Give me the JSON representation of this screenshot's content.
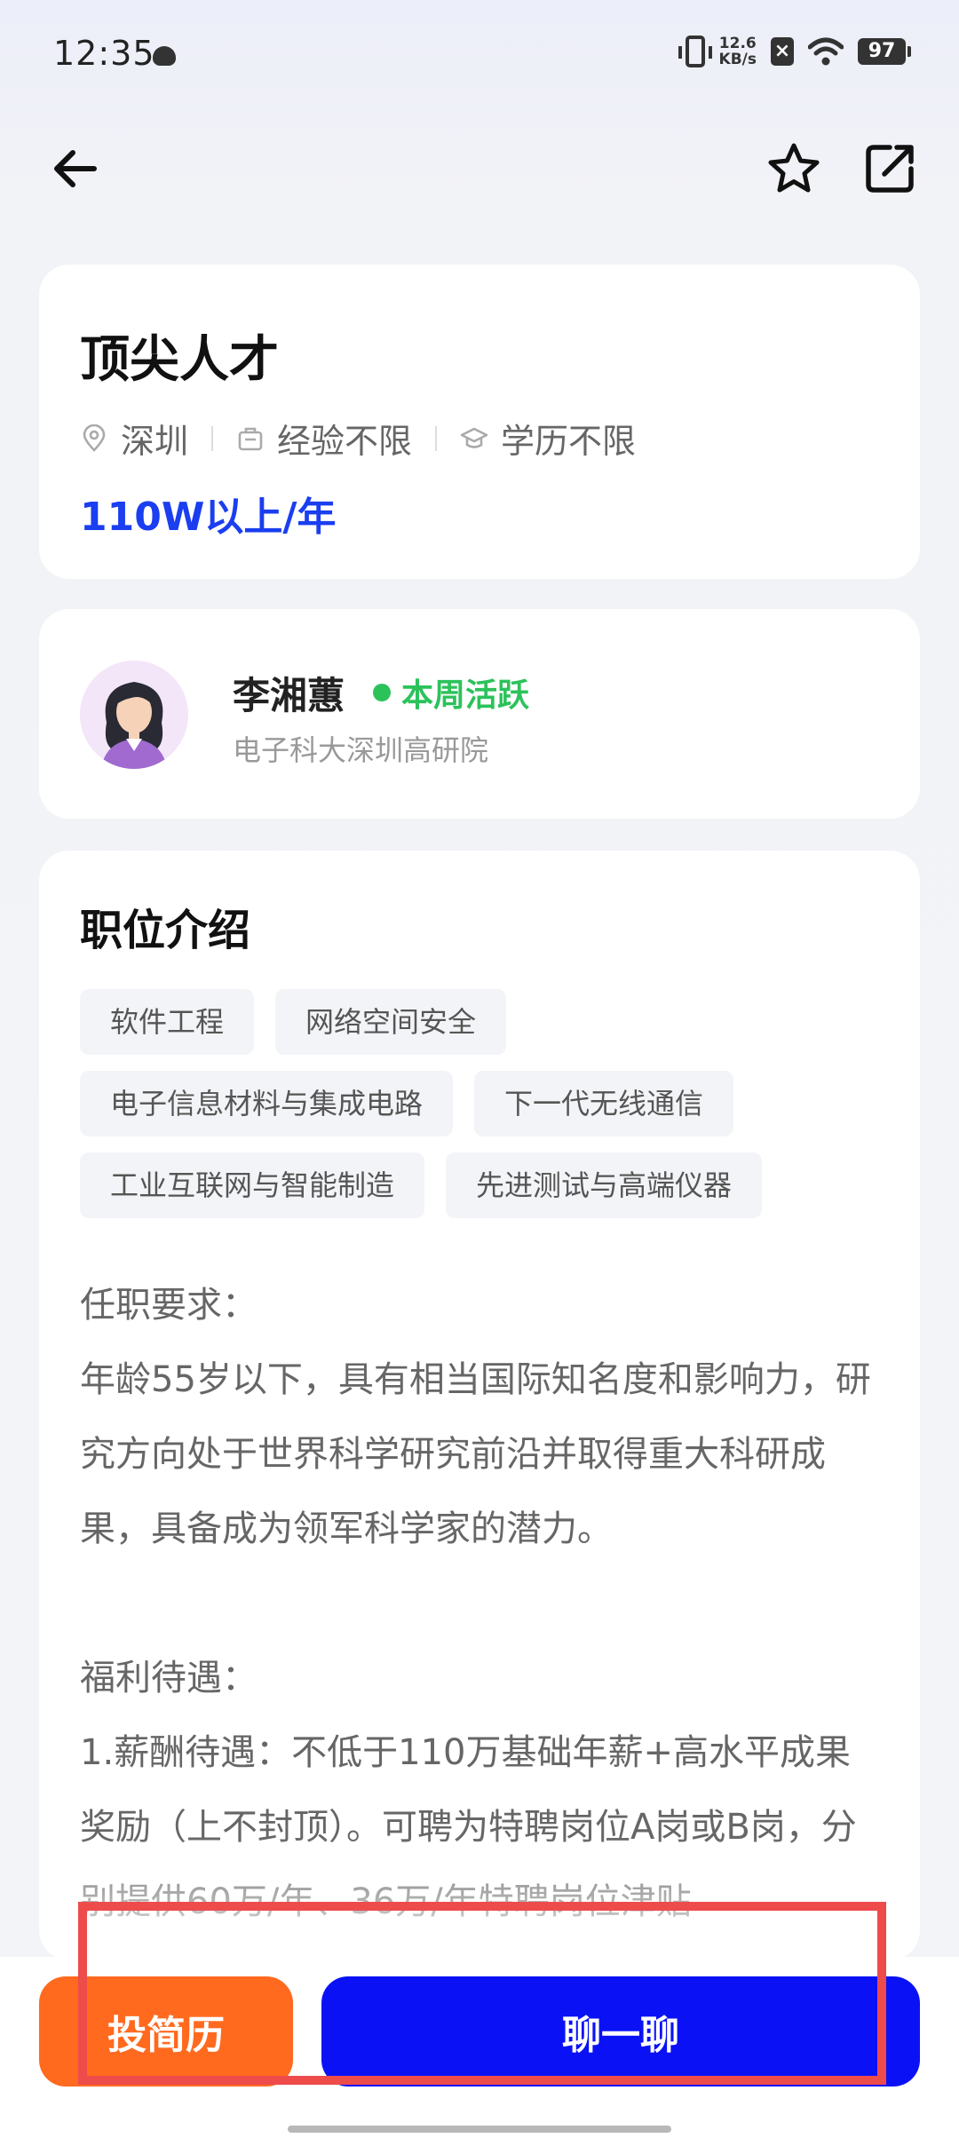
{
  "status_bar": {
    "time": "12:35",
    "net_speed_value": "12.6",
    "net_speed_unit": "KB/s",
    "battery": "97",
    "x_label": "×"
  },
  "job": {
    "title": "顶尖人才",
    "location": "深圳",
    "experience": "经验不限",
    "education": "学历不限",
    "salary": "110W以上/年"
  },
  "recruiter": {
    "name": "李湘蕙",
    "status": "本周活跃",
    "organization": "电子科大深圳高研院"
  },
  "description": {
    "heading": "职位介绍",
    "tags": [
      [
        "软件工程",
        "网络空间安全"
      ],
      [
        "电子信息材料与集成电路",
        "下一代无线通信"
      ],
      [
        "工业互联网与智能制造",
        "先进测试与高端仪器"
      ]
    ],
    "body": "任职要求：\n年龄55岁以下，具有相当国际知名度和影响力，研究方向处于世界科学研究前沿并取得重大科研成果，具备成为领军科学家的潜力。\n\n福利待遇：\n1.薪酬待遇：不低于110万基础年薪+高水平成果奖励（上不封顶）。可聘为特聘岗位A岗或B岗，分别提供60万/年、36万/年特聘岗位津贴"
  },
  "actions": {
    "apply_label": "投简历",
    "chat_label": "聊一聊"
  },
  "colors": {
    "salary": "#1a3ef0",
    "active": "#2cc25a",
    "apply_button": "#ff6a1f",
    "chat_button": "#0a12f5",
    "highlight": "#ee4b4b"
  }
}
